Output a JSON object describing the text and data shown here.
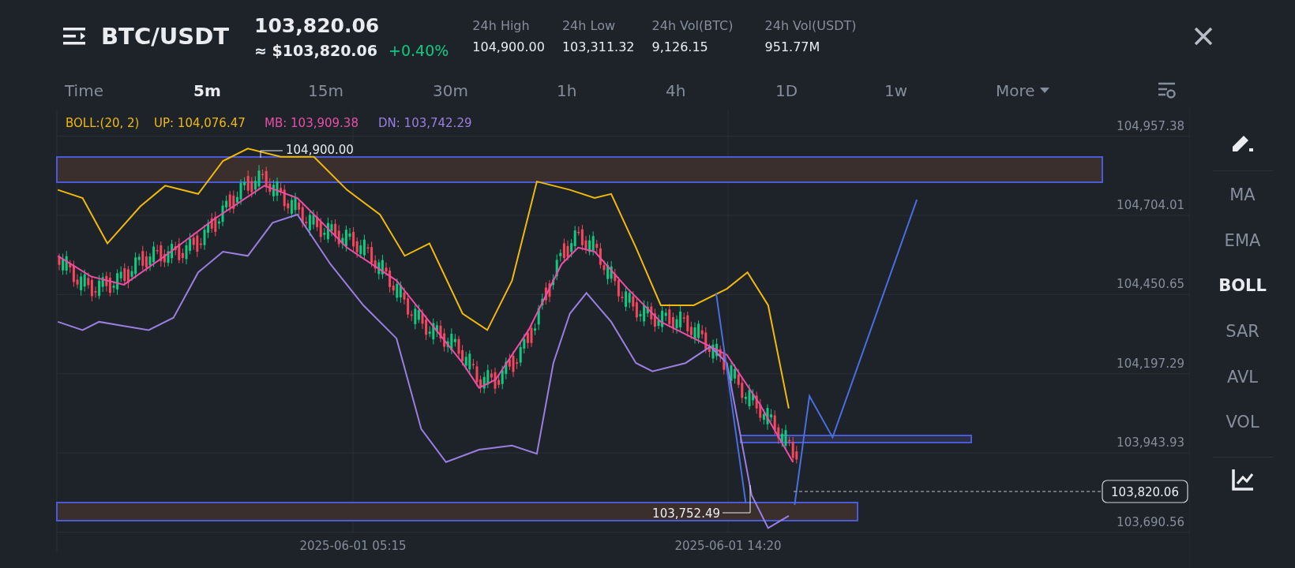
{
  "header": {
    "pair": "BTC/USDT",
    "price": "103,820.06",
    "price_usd": "≈ $103,820.06",
    "change": "+0.40%",
    "stats": [
      {
        "label": "24h High",
        "value": "104,900.00"
      },
      {
        "label": "24h Low",
        "value": "103,311.32"
      },
      {
        "label": "24h Vol(BTC)",
        "value": "9,126.15"
      },
      {
        "label": "24h Vol(USDT)",
        "value": "951.77M"
      }
    ]
  },
  "timeframes": [
    {
      "label": "Time",
      "selected": false
    },
    {
      "label": "5m",
      "selected": true
    },
    {
      "label": "15m",
      "selected": false
    },
    {
      "label": "30m",
      "selected": false
    },
    {
      "label": "1h",
      "selected": false
    },
    {
      "label": "4h",
      "selected": false
    },
    {
      "label": "1D",
      "selected": false
    },
    {
      "label": "1w",
      "selected": false
    }
  ],
  "more": {
    "label": "More"
  },
  "legend": [
    {
      "text": "BOLL:(20, 2)",
      "color": "#f0b90b"
    },
    {
      "text": "UP: 104,076.47",
      "color": "#f0b90b"
    },
    {
      "text": "MB: 103,909.38",
      "color": "#e84fa8"
    },
    {
      "text": "DN: 103,742.29",
      "color": "#9b7ee0"
    }
  ],
  "chart": {
    "y_labels": [
      "104,957.38",
      "104,704.01",
      "104,450.65",
      "104,197.29",
      "103,943.93",
      "103,690.56"
    ],
    "x_labels": [
      "2025-06-01 05:15",
      "2025-06-01 14:20"
    ],
    "current_price": "103,820.06",
    "high_label": "104,900.00",
    "low_label": "103,752.49"
  },
  "indicators": [
    {
      "label": "MA",
      "selected": false
    },
    {
      "label": "EMA",
      "selected": false
    },
    {
      "label": "BOLL",
      "selected": true
    },
    {
      "label": "SAR",
      "selected": false
    },
    {
      "label": "AVL",
      "selected": false
    },
    {
      "label": "VOL",
      "selected": false
    }
  ]
}
